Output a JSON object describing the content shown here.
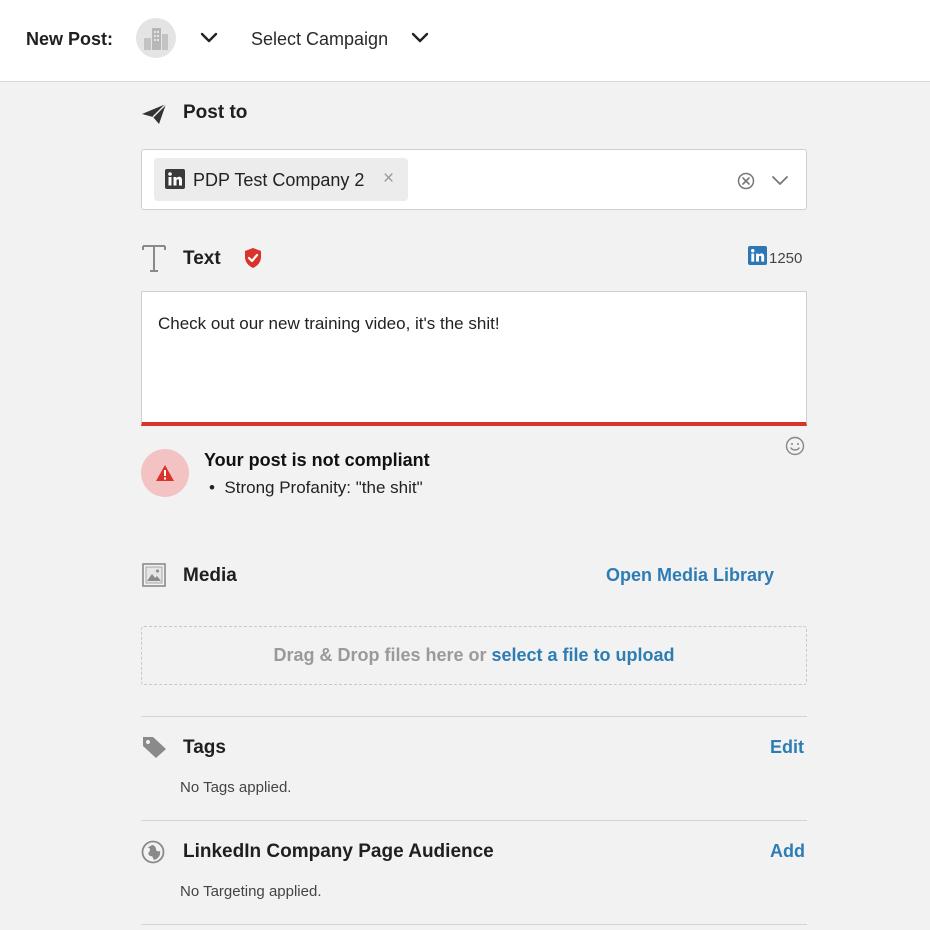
{
  "header": {
    "new_post_label": "New Post:",
    "campaign_label": "Select Campaign",
    "avatar_icon": "building-icon"
  },
  "post_to": {
    "title": "Post to",
    "selected_account": "PDP Test Company 2",
    "remove_symbol": "×",
    "network_icon": "linkedin-icon"
  },
  "text_section": {
    "title": "Text",
    "char_count": "1250",
    "value": "Check out our new training video, it's the shit!",
    "accent_color": "#d9342b"
  },
  "compliance": {
    "title": "Your post is not compliant",
    "issues": [
      "Strong Profanity: \"the shit\""
    ]
  },
  "media": {
    "title": "Media",
    "open_library_label": "Open Media Library",
    "drop_text": "Drag & Drop files here or",
    "select_file_label": "select a file to upload"
  },
  "tags": {
    "title": "Tags",
    "edit_label": "Edit",
    "empty_text": "No Tags applied."
  },
  "audience": {
    "title": "LinkedIn Company Page Audience",
    "add_label": "Add",
    "empty_text": "No Targeting applied."
  },
  "colors": {
    "link": "#2d7db5",
    "linkedin": "#2e77b5",
    "error": "#d9342b"
  }
}
